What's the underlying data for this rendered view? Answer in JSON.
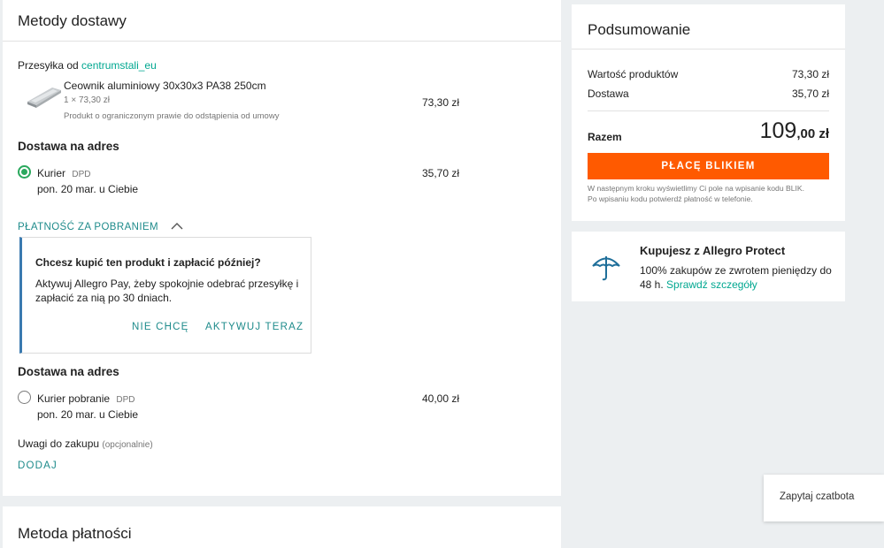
{
  "main": {
    "title": "Metody dostawy",
    "seller_prefix": "Przesyłka od",
    "seller_name": "centrumstali_eu",
    "product": {
      "name": "Ceownik aluminiowy 30x30x3 PA38 250cm",
      "qty_line": "1 × 73,30 zł",
      "note": "Produkt o ograniczonym prawie do odstąpienia od umowy",
      "price": "73,30 zł"
    },
    "delivery1": {
      "heading": "Dostawa na adres",
      "option": "Kurier",
      "carrier": "DPD",
      "date": "pon. 20 mar. u Ciebie",
      "price": "35,70 zł",
      "selected": true
    },
    "cod_toggle": "PŁATNOŚĆ ZA POBRANIEM",
    "pay_later": {
      "title": "Chcesz kupić ten produkt i zapłacić później?",
      "text1": "Aktywuj Allegro Pay, żeby spokojnie odebrać przesyłkę i",
      "text2": "zapłacić za nią po 30 dniach.",
      "decline": "NIE CHCĘ",
      "activate": "AKTYWUJ TERAZ"
    },
    "delivery2": {
      "heading": "Dostawa na adres",
      "option": "Kurier pobranie",
      "carrier": "DPD",
      "date": "pon. 20 mar. u Ciebie",
      "price": "40,00 zł",
      "selected": false
    },
    "notes_label": "Uwagi do zakupu",
    "notes_optional": "(opcjonalnie)",
    "notes_add": "DODAJ"
  },
  "payment": {
    "title": "Metoda płatności"
  },
  "summary": {
    "title": "Podsumowanie",
    "products_label": "Wartość produktów",
    "products_value": "73,30 zł",
    "delivery_label": "Dostawa",
    "delivery_value": "35,70 zł",
    "total_label": "Razem",
    "total_main": "109",
    "total_cents": ",00 zł",
    "cta": "PŁACĘ BLIKIEM",
    "info1": "W następnym kroku wyświetlimy Ci pole na wpisanie kodu BLIK.",
    "info2": "Po wpisaniu kodu potwierdź płatność w telefonie."
  },
  "protect": {
    "title": "Kupujesz z Allegro Protect",
    "text1": "100% zakupów ze zwrotem pieniędzy do",
    "text2_prefix": "48 h.",
    "link": "Sprawdź szczegóły"
  },
  "chatbot": {
    "label": "Zapytaj czatbota"
  },
  "colors": {
    "accent": "#ff5a00",
    "teal": "#00a790",
    "green": "#2aa85d"
  }
}
